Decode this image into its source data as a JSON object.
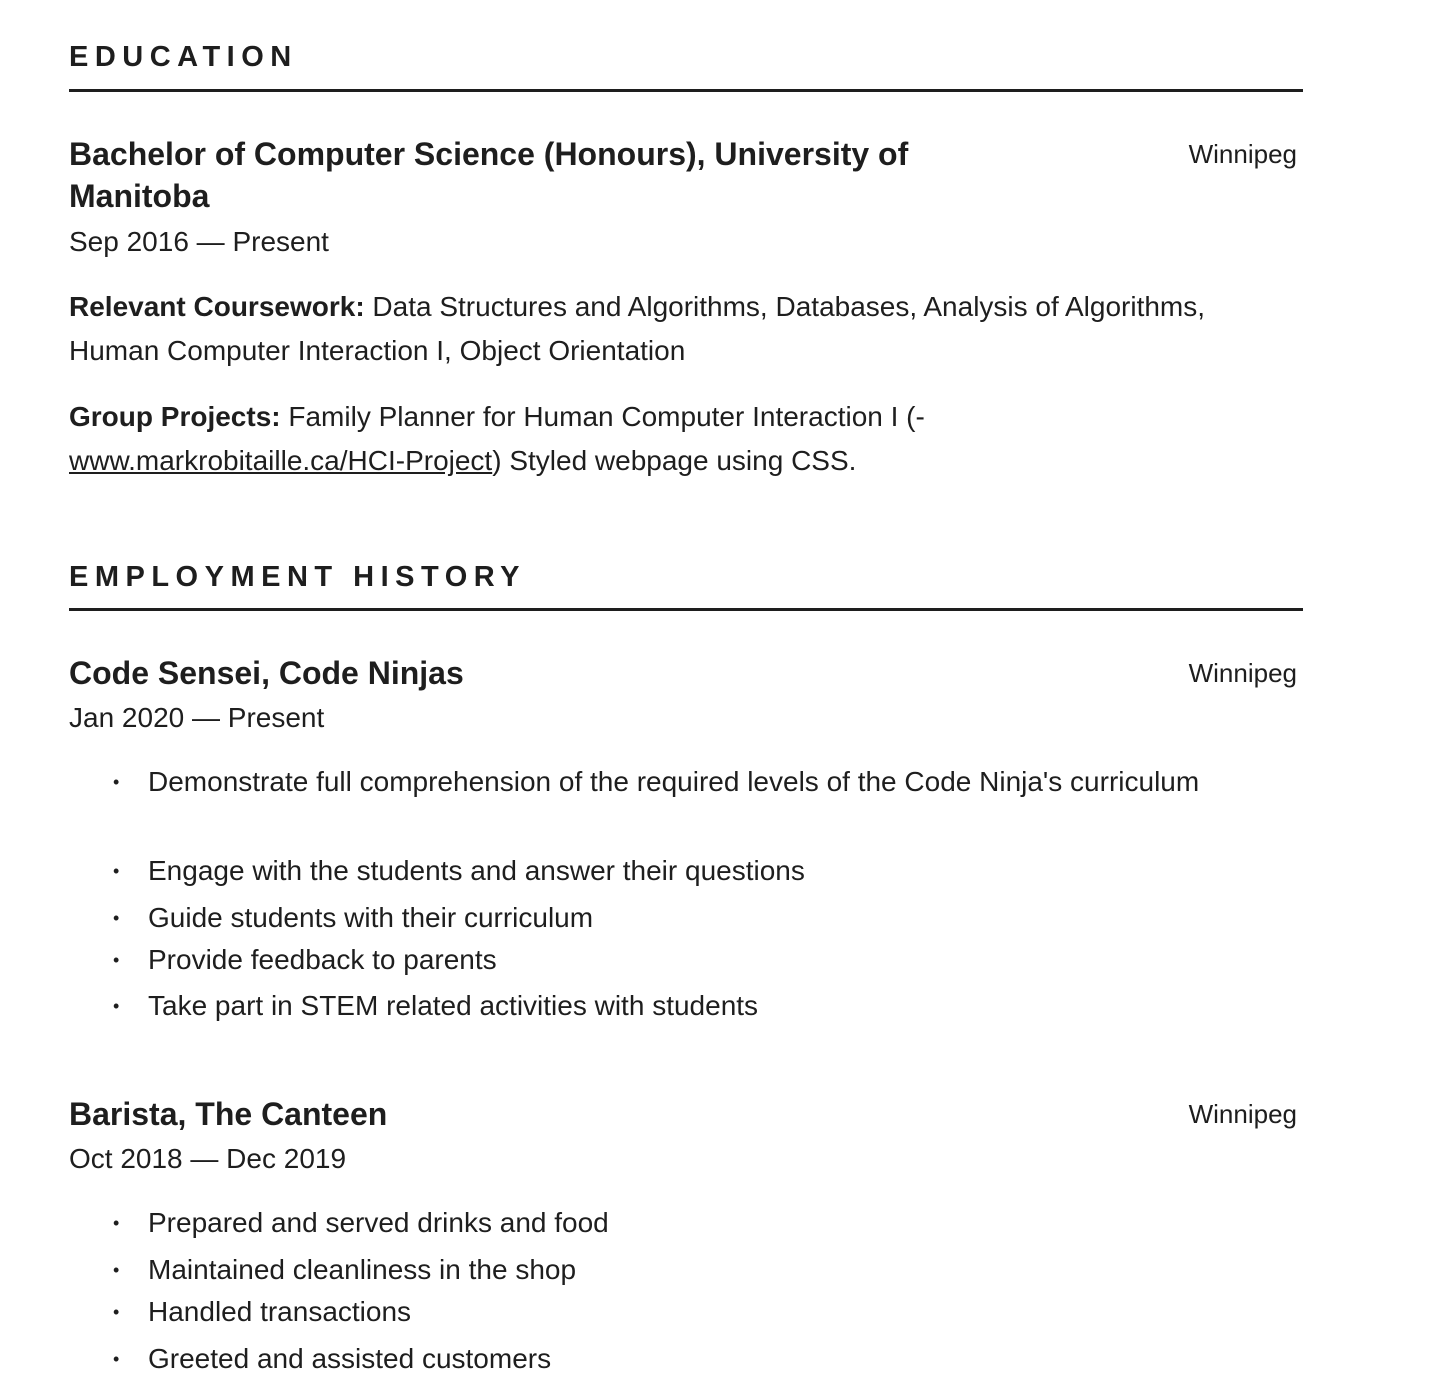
{
  "education": {
    "heading": "EDUCATION",
    "degree_title": "Bachelor of Computer Science (Honours), University of Manitoba",
    "location": "Winnipeg",
    "dates": "Sep 2016 — Present",
    "coursework_label": "Relevant Coursework:",
    "coursework_text": " Data Structures and Algorithms, Databases, Analysis of Algorithms, Human Computer Interaction I, Object Orientation",
    "projects_label": "Group Projects:",
    "projects_text_before": " Family Planner for Human Computer Interaction I  (-",
    "projects_link": "www.markrobitaille.ca/HCI-Project",
    "projects_text_after": ") Styled webpage using CSS."
  },
  "employment": {
    "heading": "EMPLOYMENT HISTORY",
    "jobs": [
      {
        "title": "Code Sensei, Code Ninjas",
        "location": "Winnipeg",
        "dates": "Jan 2020 — Present",
        "bullets": [
          "Demonstrate full comprehension of the required levels of the Code Ninja's curriculum",
          "Engage with the students and answer their questions",
          "Guide students with their curriculum",
          "Provide feedback to parents",
          "Take part in STEM related activities with students"
        ]
      },
      {
        "title": "Barista, The Canteen",
        "location": "Winnipeg",
        "dates": "Oct 2018 — Dec 2019",
        "bullets": [
          "Prepared and served drinks and food",
          "Maintained cleanliness in the shop",
          "Handled transactions",
          "Greeted and assisted customers"
        ]
      }
    ]
  }
}
